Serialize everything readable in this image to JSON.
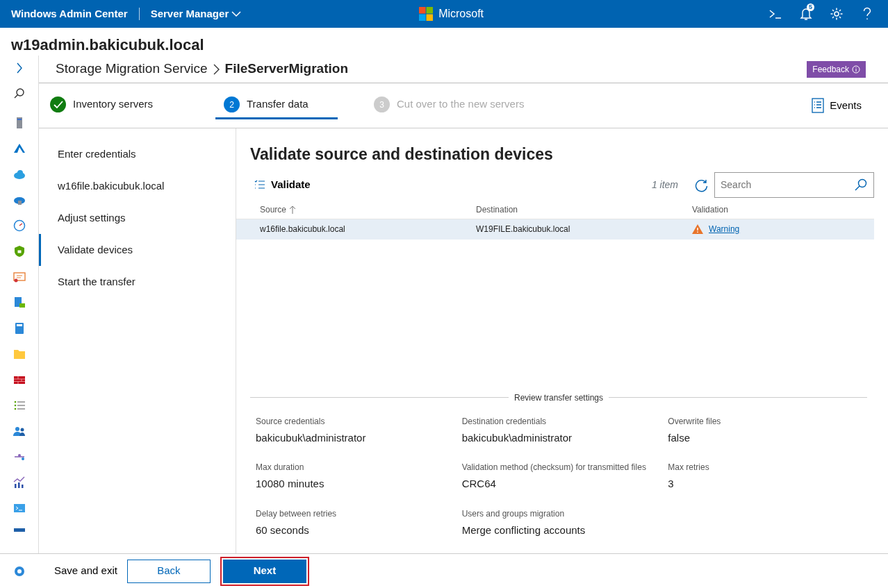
{
  "app": {
    "title": "Windows Admin Center",
    "tool": "Server Manager",
    "brand": "Microsoft",
    "notification_count": "5"
  },
  "server": "w19admin.bakicubuk.local",
  "breadcrumb": {
    "parent": "Storage Migration Service",
    "current": "FileServerMigration"
  },
  "feedback": "Feedback",
  "steps": [
    {
      "label": "Inventory servers",
      "kind": "done",
      "selected": false
    },
    {
      "number": "2",
      "label": "Transfer data",
      "kind": "current",
      "selected": true
    },
    {
      "number": "3",
      "label": "Cut over to the new servers",
      "kind": "pending",
      "selected": false
    }
  ],
  "events": "Events",
  "substeps": [
    {
      "label": "Enter credentials",
      "selected": false
    },
    {
      "label": "w16file.bakicubuk.local",
      "selected": false
    },
    {
      "label": "Adjust settings",
      "selected": false
    },
    {
      "label": "Validate devices",
      "selected": true
    },
    {
      "label": "Start the transfer",
      "selected": false
    }
  ],
  "panel": {
    "title": "Validate source and destination devices",
    "action": "Validate",
    "count": "1 item",
    "search": {
      "placeholder": "Search"
    },
    "columns": [
      {
        "label": "Source",
        "sorted": true
      },
      {
        "label": "Destination",
        "sorted": false
      },
      {
        "label": "Validation",
        "sorted": false
      }
    ],
    "rows": [
      {
        "source": "w16file.bakicubuk.local",
        "destination": "W19FILE.bakicubuk.local",
        "validation": "Warning",
        "kind": "warning",
        "selected": true
      }
    ]
  },
  "review": {
    "title": "Review transfer settings",
    "fields": [
      {
        "label": "Source credentials",
        "value": "bakicubuk\\administrator"
      },
      {
        "label": "Destination credentials",
        "value": "bakicubuk\\administrator"
      },
      {
        "label": "Overwrite files",
        "value": "false"
      },
      {
        "label": "Max duration",
        "value": "10080 minutes"
      },
      {
        "label": "Validation method (checksum) for transmitted files",
        "value": "CRC64"
      },
      {
        "label": "Max retries",
        "value": "3"
      },
      {
        "label": "Delay between retries",
        "value": "60 seconds"
      },
      {
        "label": "Users and groups migration",
        "value": "Merge conflicting accounts"
      }
    ]
  },
  "footer": {
    "save": "Save and exit",
    "back": "Back",
    "next": "Next",
    "next_highlighted": true
  }
}
